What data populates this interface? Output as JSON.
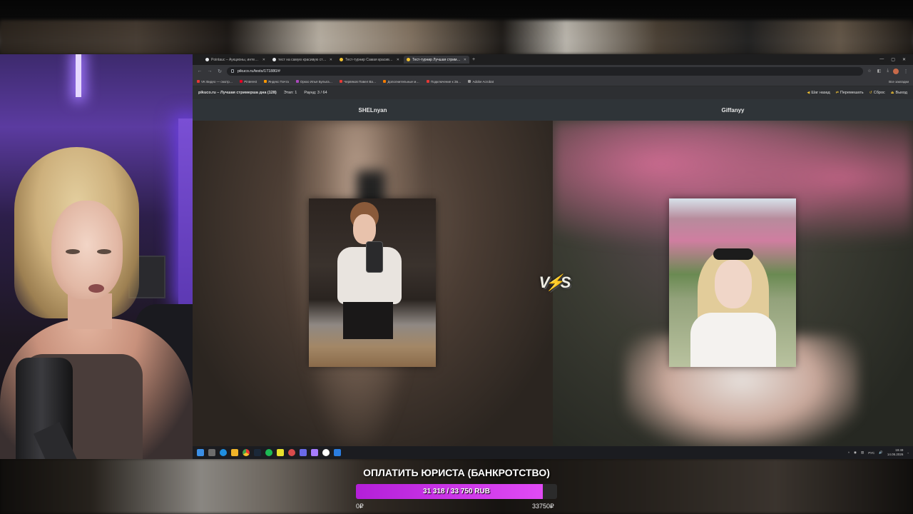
{
  "browser": {
    "tabs": [
      {
        "label": "Pointauc – Аукционы, интерак…",
        "icon_color": "#e8eaed",
        "active": false
      },
      {
        "label": "тест на самую красивую стри…",
        "icon_color": "#e8eaed",
        "active": false
      },
      {
        "label": "Тест-турнир Самая красивая…",
        "icon_color": "#f1c232",
        "active": false
      },
      {
        "label": "Тест-турнир Лучшая стример…",
        "icon_color": "#f1c232",
        "active": true
      }
    ],
    "url": "pikuco.ru/tests/171880/#",
    "bookmarks": [
      {
        "label": "VK Видео — смотр…",
        "color": "#e53935"
      },
      {
        "label": "Pinterest",
        "color": "#e60023"
      },
      {
        "label": "Яндекс Почта",
        "color": "#ff9800"
      },
      {
        "label": "Оркхо Илья Булыга…",
        "color": "#ab47bc"
      },
      {
        "label": "Червяков Павел Ва…",
        "color": "#e53935"
      },
      {
        "label": "Дополнительные м…",
        "color": "#f57c00"
      },
      {
        "label": "Подключение к Зв…",
        "color": "#e53935"
      },
      {
        "label": "Adobe Acrobat",
        "color": "#9e9e9e"
      }
    ],
    "bookmarks_all": "Все закладки"
  },
  "site": {
    "title": "pikuco.ru – Лучшая стримерша дна (128)",
    "stage": "Этап: 1",
    "round": "Раунд: 3 / 64",
    "actions": [
      "Шаг назад",
      "Перемешать",
      "Сброс",
      "Выход"
    ]
  },
  "match": {
    "left_name": "SHELnyan",
    "right_name": "Giffanyy"
  },
  "taskbar": {
    "lang": "РУС",
    "time": "19:49",
    "date": "14.05.2026"
  },
  "goal": {
    "title": "ОПЛАТИТЬ ЮРИСТА (БАНКРОТСТВО)",
    "progress_text": "31 318 / 33 750 RUB",
    "current": 31318,
    "target": 33750,
    "min_label": "0₽",
    "max_label": "33750₽",
    "fill_color": "#c22fe6"
  }
}
